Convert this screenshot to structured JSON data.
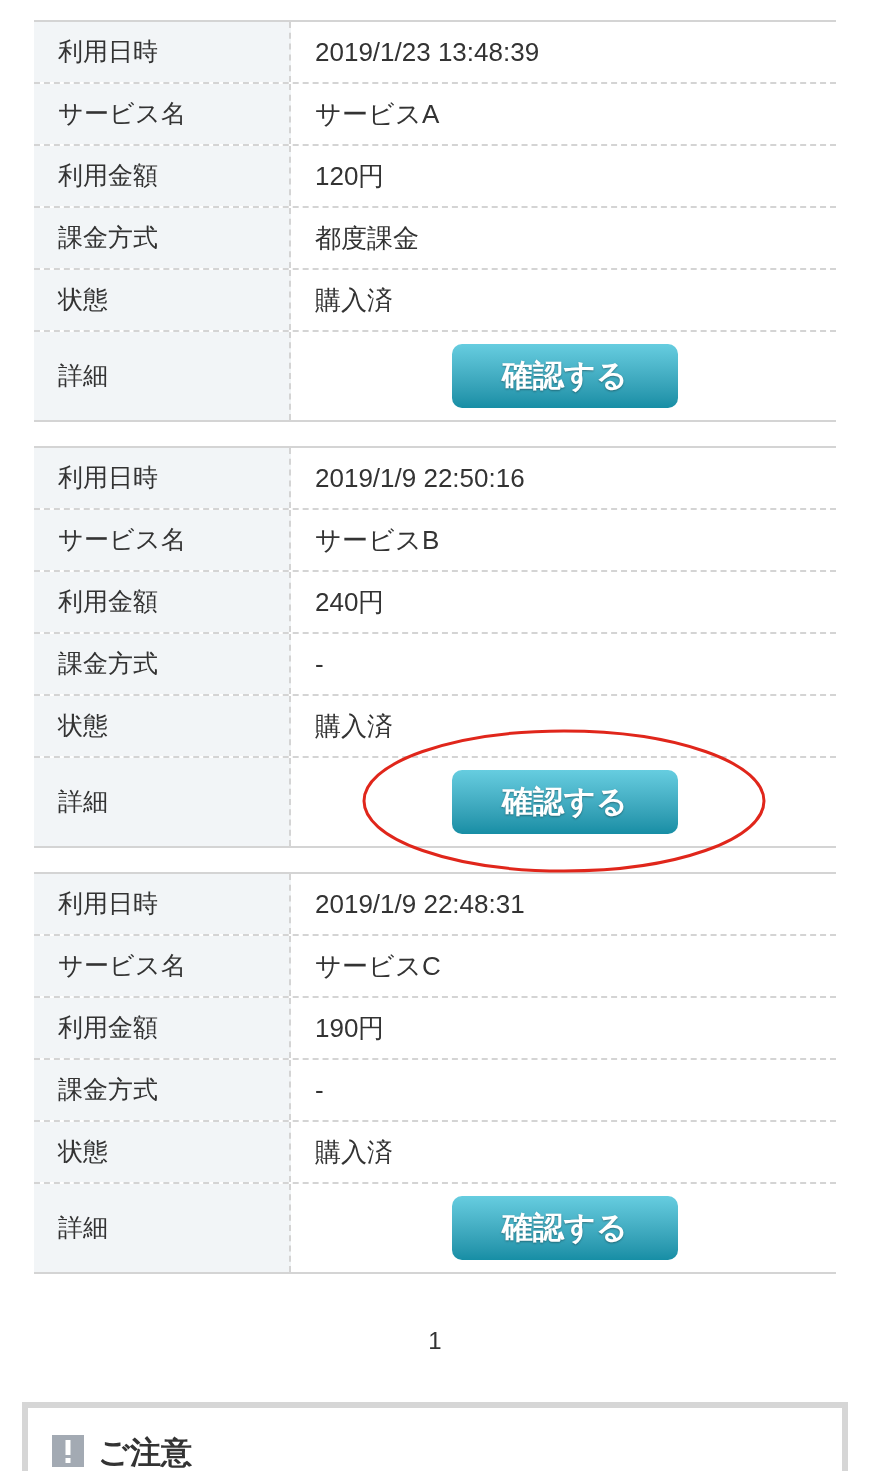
{
  "records": [
    {
      "rows": [
        {
          "label": "利用日時",
          "value": "2019/1/23 13:48:39"
        },
        {
          "label": "サービス名",
          "value": "サービスA"
        },
        {
          "label": "利用金額",
          "value": "120円"
        },
        {
          "label": "課金方式",
          "value": "都度課金"
        },
        {
          "label": "状態",
          "value": "購入済"
        }
      ],
      "detail_label": "詳細",
      "button": "確認する",
      "highlighted": false
    },
    {
      "rows": [
        {
          "label": "利用日時",
          "value": "2019/1/9 22:50:16"
        },
        {
          "label": "サービス名",
          "value": "サービスB"
        },
        {
          "label": "利用金額",
          "value": "240円"
        },
        {
          "label": "課金方式",
          "value": "-"
        },
        {
          "label": "状態",
          "value": "購入済"
        }
      ],
      "detail_label": "詳細",
      "button": "確認する",
      "highlighted": true
    },
    {
      "rows": [
        {
          "label": "利用日時",
          "value": "2019/1/9 22:48:31"
        },
        {
          "label": "サービス名",
          "value": "サービスC"
        },
        {
          "label": "利用金額",
          "value": "190円"
        },
        {
          "label": "課金方式",
          "value": "-"
        },
        {
          "label": "状態",
          "value": "購入済"
        }
      ],
      "detail_label": "詳細",
      "button": "確認する",
      "highlighted": false
    }
  ],
  "pagination": {
    "pages": [
      {
        "label": "1",
        "selected": true
      }
    ]
  },
  "notice": {
    "title": "ご注意"
  }
}
